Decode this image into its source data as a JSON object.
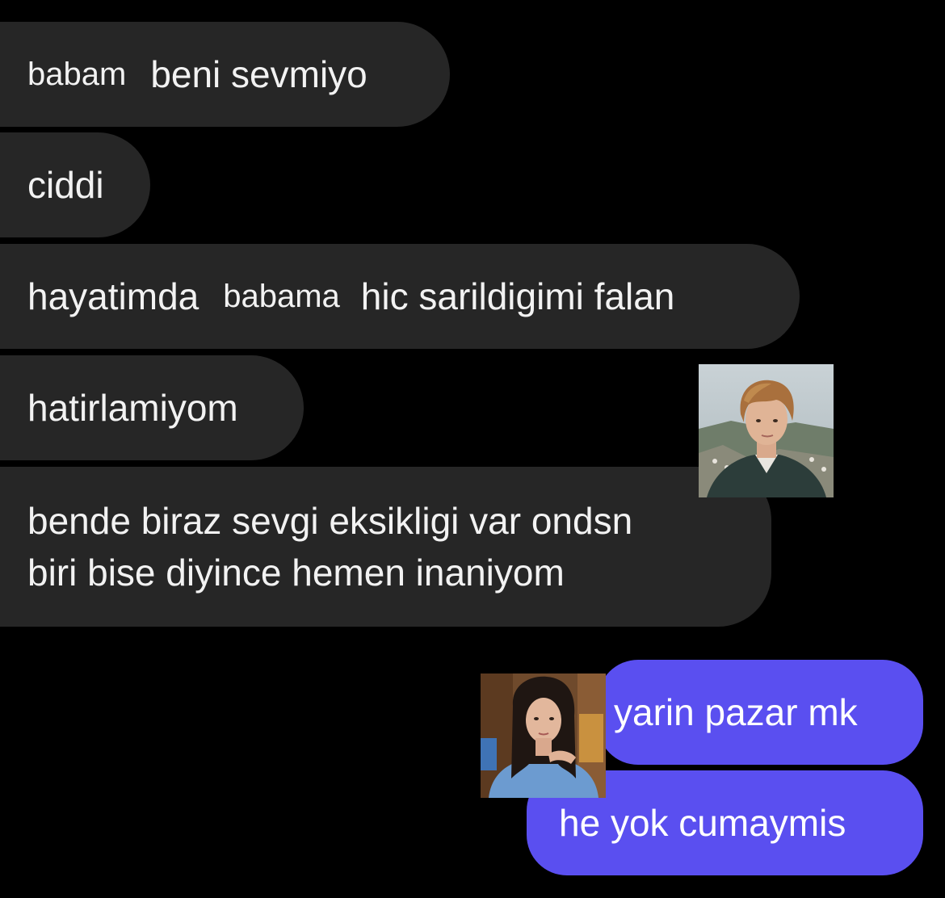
{
  "received_messages": [
    {
      "parts": [
        "babam",
        "beni sevmiyo"
      ]
    },
    {
      "text": "ciddi"
    },
    {
      "parts": [
        "hayatimda",
        "babama",
        "hic sarildigimi falan"
      ]
    },
    {
      "text": "hatirlamiyom"
    },
    {
      "lines": [
        "bende biraz sevgi eksikligi var ondsn",
        "biri bise diyince hemen inaniyom"
      ]
    }
  ],
  "sent_messages": [
    {
      "text": "yarin pazar mk"
    },
    {
      "text": "he yok cumaymis"
    }
  ],
  "colors": {
    "background": "#000000",
    "received_bubble": "#262626",
    "sent_bubble": "#5a4ff0",
    "text": "#f2f2f2"
  },
  "icons": {
    "received_avatar": "boy-portrait-avatar",
    "sent_avatar": "girl-portrait-avatar"
  }
}
